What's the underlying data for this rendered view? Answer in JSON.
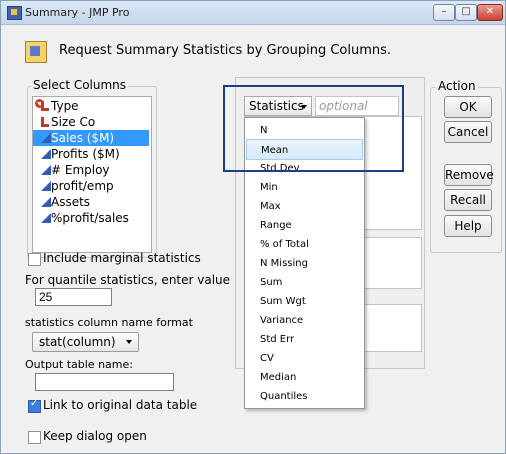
{
  "window": {
    "title": "Summary - JMP Pro",
    "min_glyph": "–",
    "max_glyph": "□",
    "close_glyph": "✕"
  },
  "header": {
    "text": "Request Summary Statistics by Grouping Columns."
  },
  "select_columns": {
    "label": "Select Columns",
    "items": [
      {
        "label": "Type",
        "icon": "nominal-icon",
        "selected": false
      },
      {
        "label": "Size Co",
        "icon": "nominal-icon",
        "selected": false
      },
      {
        "label": "Sales ($M)",
        "icon": "continuous-icon",
        "selected": true
      },
      {
        "label": "Profits ($M)",
        "icon": "continuous-icon",
        "selected": false
      },
      {
        "label": "# Employ",
        "icon": "continuous-icon",
        "selected": false
      },
      {
        "label": "profit/emp",
        "icon": "continuous-icon",
        "selected": false
      },
      {
        "label": "Assets",
        "icon": "continuous-icon",
        "selected": false
      },
      {
        "label": "%profit/sales",
        "icon": "continuous-icon",
        "selected": false
      }
    ]
  },
  "options": {
    "marginal_label": "Include marginal statistics",
    "quantile_label": "For quantile statistics, enter value (%)",
    "quantile_value": "25",
    "name_format_label": "statistics column name format",
    "name_format_value": "stat(column)",
    "output_label": "Output table name:",
    "output_value": "",
    "link_label": "Link to original data table",
    "keep_label": "Keep dialog open"
  },
  "roles": {
    "statistics_label": "Statistics",
    "optional_placeholder": "optional"
  },
  "stats_menu": [
    "N",
    "Mean",
    "Std Dev",
    "Min",
    "Max",
    "Range",
    "% of Total",
    "N Missing",
    "Sum",
    "Sum Wgt",
    "Variance",
    "Std Err",
    "CV",
    "Median",
    "Quantiles"
  ],
  "action": {
    "label": "Action",
    "ok": "OK",
    "cancel": "Cancel",
    "remove": "Remove",
    "recall": "Recall",
    "help": "Help"
  }
}
